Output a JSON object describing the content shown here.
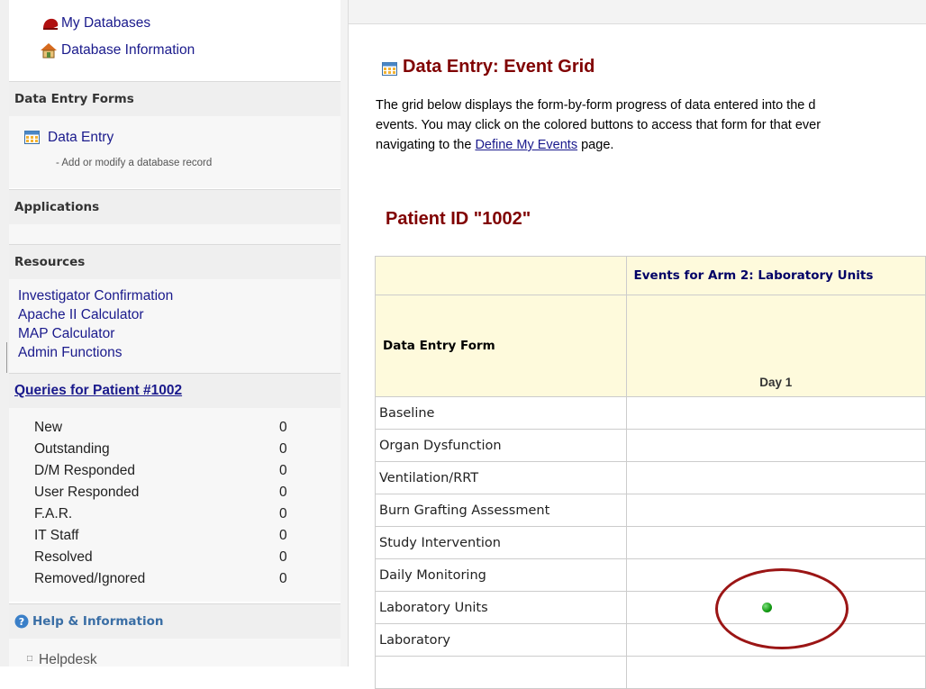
{
  "sidebar": {
    "top_links": [
      {
        "label": "My Databases",
        "icon": "red-cap-icon"
      },
      {
        "label": "Database Information",
        "icon": "house-icon"
      }
    ],
    "data_entry_forms": {
      "header": "Data Entry Forms",
      "link": "Data Entry",
      "sublabel": "- Add or modify a database record",
      "icon": "grid-icon"
    },
    "applications": {
      "header": "Applications"
    },
    "resources": {
      "header": "Resources",
      "links": [
        "Investigator Confirmation",
        "Apache II Calculator",
        "MAP Calculator",
        "Admin Functions"
      ]
    },
    "queries": {
      "header": "Queries for Patient #1002",
      "rows": [
        {
          "label": "New",
          "count": "0"
        },
        {
          "label": "Outstanding",
          "count": "0"
        },
        {
          "label": "D/M Responded",
          "count": "0"
        },
        {
          "label": "User Responded",
          "count": "0"
        },
        {
          "label": "F.A.R.",
          "count": "0"
        },
        {
          "label": "IT Staff",
          "count": "0"
        },
        {
          "label": "Resolved",
          "count": "0"
        },
        {
          "label": "Removed/Ignored",
          "count": "0"
        }
      ]
    },
    "help": {
      "header": "Help & Information",
      "link": "Helpdesk",
      "icon": "help-circle-icon"
    }
  },
  "main": {
    "title": "Data Entry: Event Grid",
    "description_line1": "The grid below displays the form-by-form progress of data entered into the d",
    "description_line2": "events. You may click on the colored buttons to access that form for that ever",
    "description_line3_pre": "navigating to the ",
    "description_line3_link": "Define My Events",
    "description_line3_post": " page.",
    "patient_heading": "Patient ID \"1002\"",
    "grid": {
      "events_header": "Events for Arm 2: Laboratory Units",
      "form_column_header": "Data Entry Form",
      "day_label": "Day 1",
      "rows": [
        "Baseline",
        "Organ Dysfunction",
        "Ventilation/RRT",
        "Burn Grafting Assessment",
        "Study Intervention",
        "Daily Monitoring",
        "Laboratory Units",
        "Laboratory"
      ],
      "status_row": "Laboratory Units",
      "status_color": "#119911"
    },
    "annotation_color": "#9b1515"
  }
}
